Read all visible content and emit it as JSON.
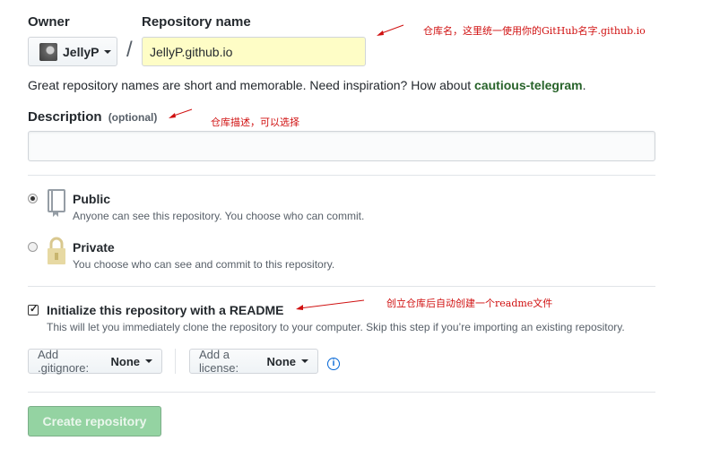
{
  "owner": {
    "label": "Owner",
    "name": "JellyP"
  },
  "repository": {
    "label": "Repository name",
    "value": "JellyP.github.io"
  },
  "slash": "/",
  "hint": {
    "text": "Great repository names are short and memorable. Need inspiration? How about ",
    "suggestion": "cautious-telegram",
    "end": "."
  },
  "description": {
    "label": "Description",
    "optional": "(optional)",
    "value": ""
  },
  "visibility": {
    "public": {
      "title": "Public",
      "note": "Anyone can see this repository. You choose who can commit.",
      "selected": true
    },
    "private": {
      "title": "Private",
      "note": "You choose who can see and commit to this repository.",
      "selected": false
    }
  },
  "readme": {
    "title": "Initialize this repository with a README",
    "note": "This will let you immediately clone the repository to your computer. Skip this step if you’re importing an existing repository.",
    "checked": true
  },
  "gitignore": {
    "label": "Add .gitignore:",
    "value": "None"
  },
  "license": {
    "label": "Add a license:",
    "value": "None"
  },
  "info_icon": "i",
  "create_button": "Create repository",
  "annotations": {
    "repo_name": "仓库名，这里统一使用你的GitHub名字.github.io",
    "description": "仓库描述，可以选择",
    "readme": "创立仓库后自动创建一个readme文件"
  },
  "colors": {
    "annotation": "#d01010",
    "repo_input_bg": "#fefdc6",
    "create_bg": "#94d3a2",
    "suggestion": "#28632a"
  }
}
